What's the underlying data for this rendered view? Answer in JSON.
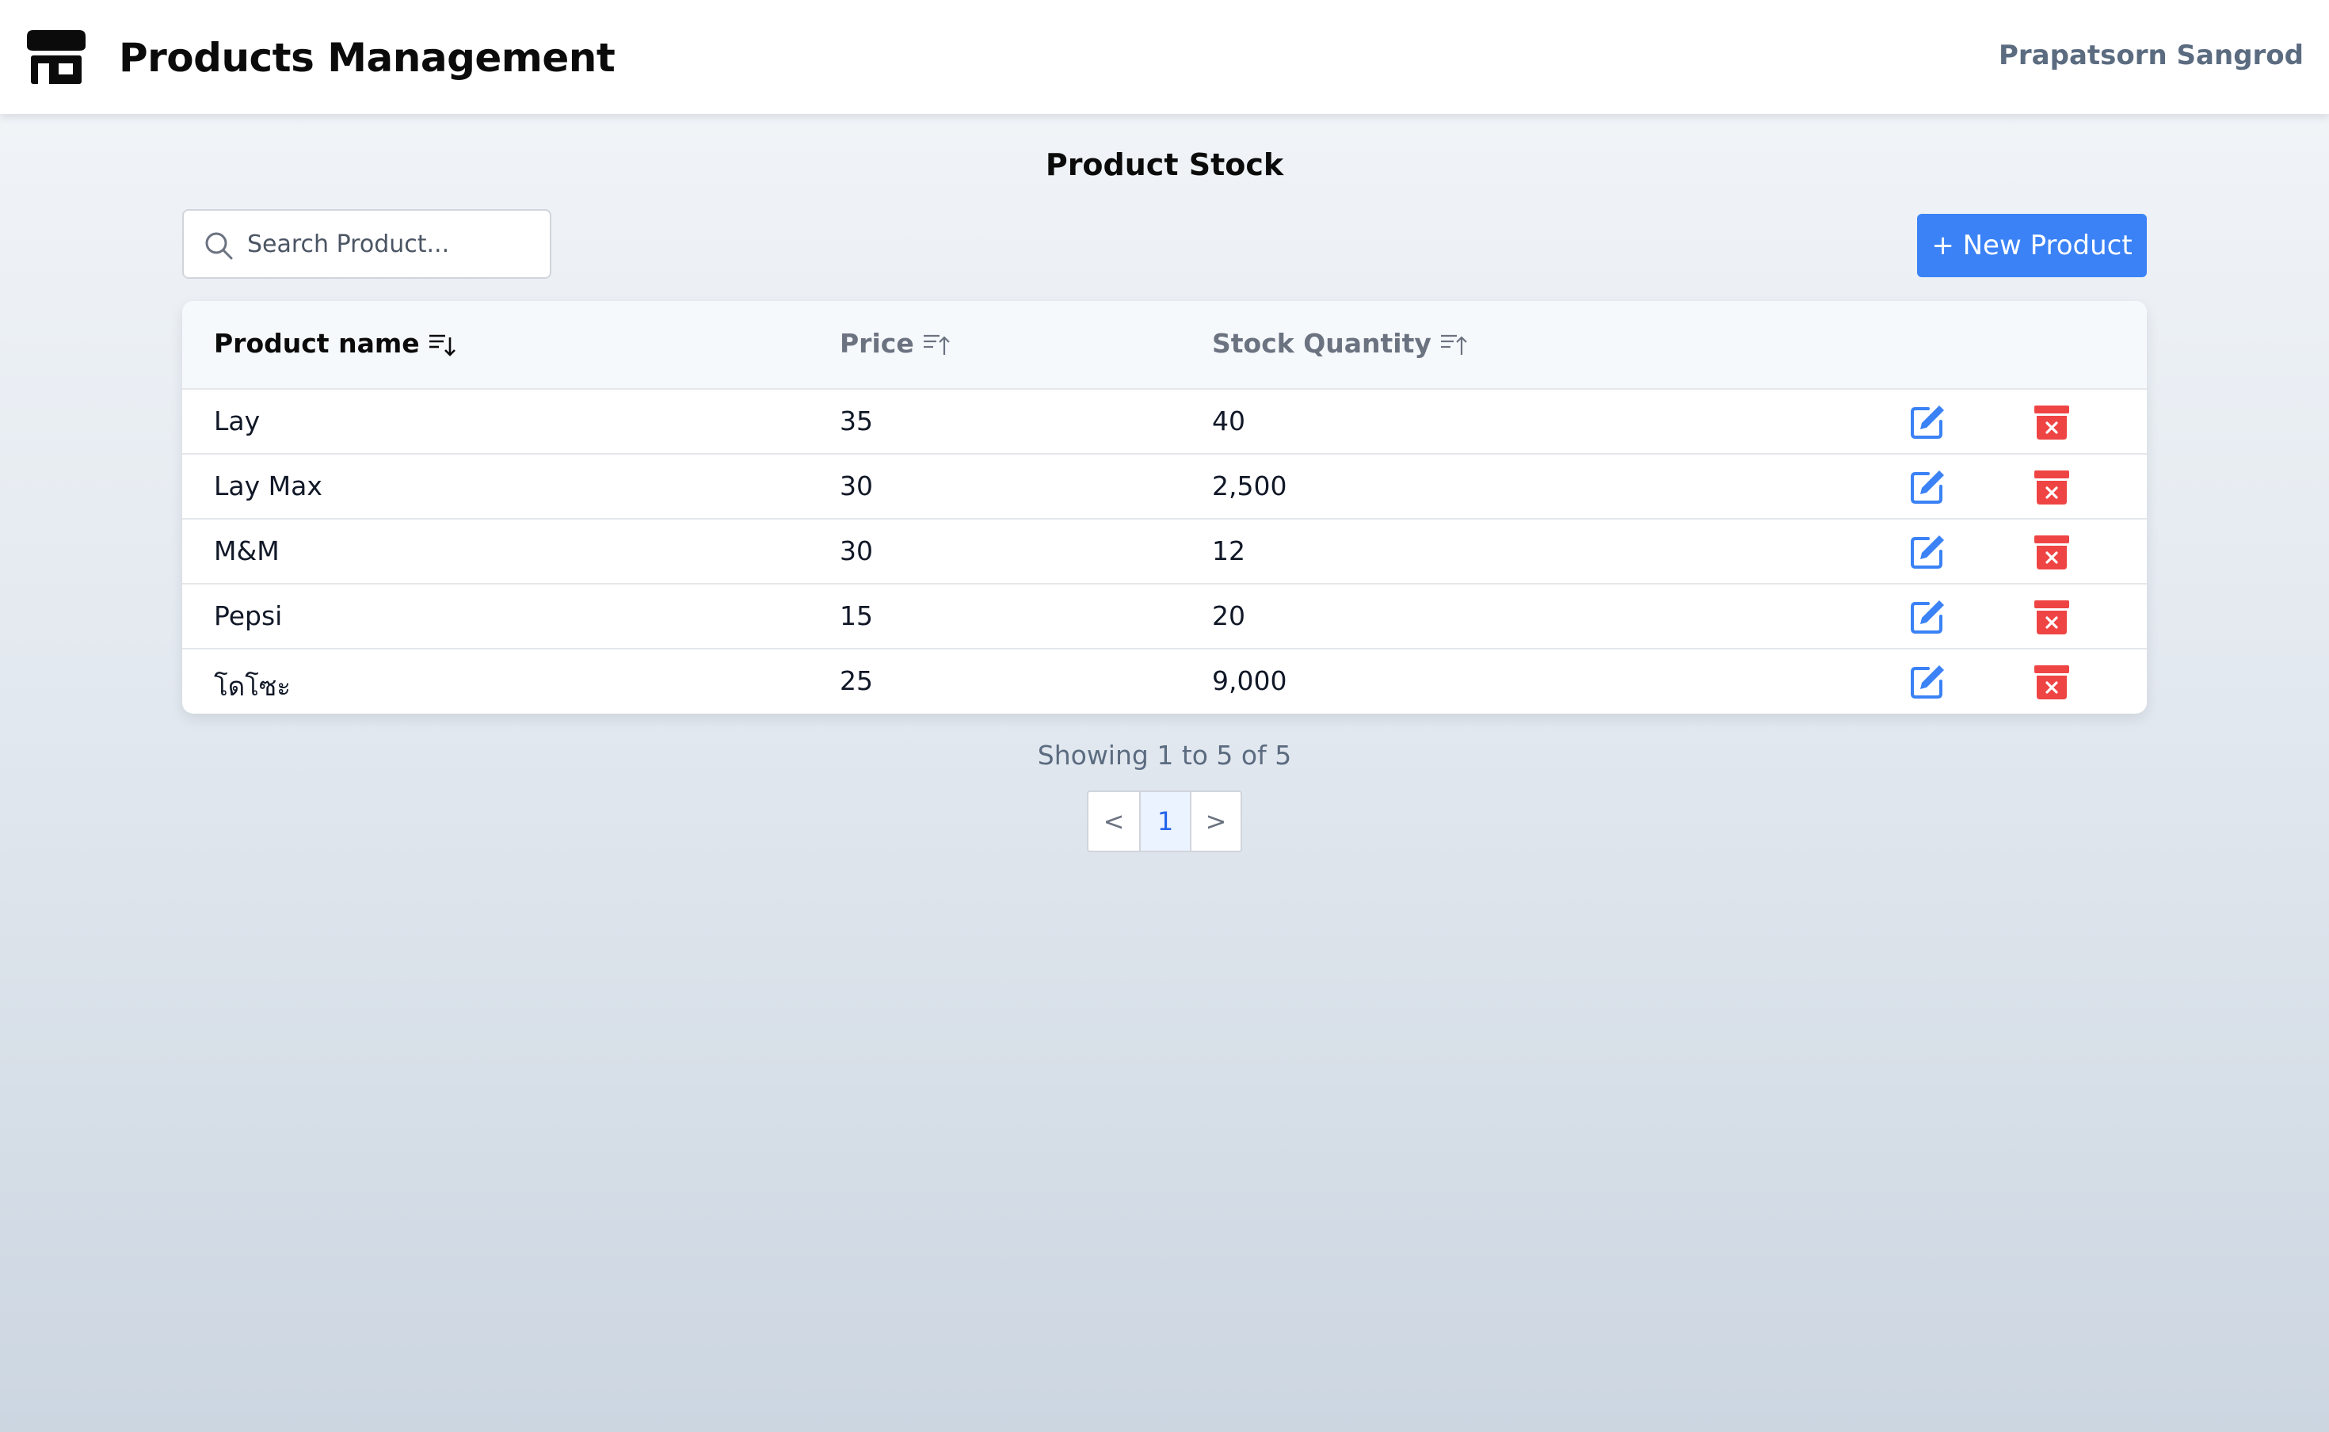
{
  "header": {
    "title": "Products Management",
    "user_name": "Prapatsorn Sangrod",
    "logo_icon": "store-icon"
  },
  "main": {
    "heading": "Product Stock",
    "search": {
      "placeholder": "Search Product...",
      "value": ""
    },
    "new_button_label": "+ New Product"
  },
  "table": {
    "columns": [
      {
        "label": "Product name",
        "sort_icon": "sort-descending-icon",
        "active": true
      },
      {
        "label": "Price",
        "sort_icon": "sort-ascending-icon",
        "active": false
      },
      {
        "label": "Stock Quantity",
        "sort_icon": "sort-ascending-icon",
        "active": false
      }
    ],
    "rows": [
      {
        "name": "Lay",
        "price": "35",
        "stock": "40"
      },
      {
        "name": "Lay Max",
        "price": "30",
        "stock": "2,500"
      },
      {
        "name": "M&M",
        "price": "30",
        "stock": "12"
      },
      {
        "name": "Pepsi",
        "price": "15",
        "stock": "20"
      },
      {
        "name": "โดโซะ",
        "price": "25",
        "stock": "9,000"
      }
    ],
    "row_actions": {
      "edit_icon": "edit-icon",
      "delete_icon": "archive-delete-icon"
    }
  },
  "pagination": {
    "summary": "Showing 1 to 5 of 5",
    "prev": "<",
    "pages": [
      "1"
    ],
    "current": "1",
    "next": ">"
  },
  "colors": {
    "primary": "#3b82f6",
    "danger": "#ef4444",
    "muted_text": "#5b6b80"
  }
}
